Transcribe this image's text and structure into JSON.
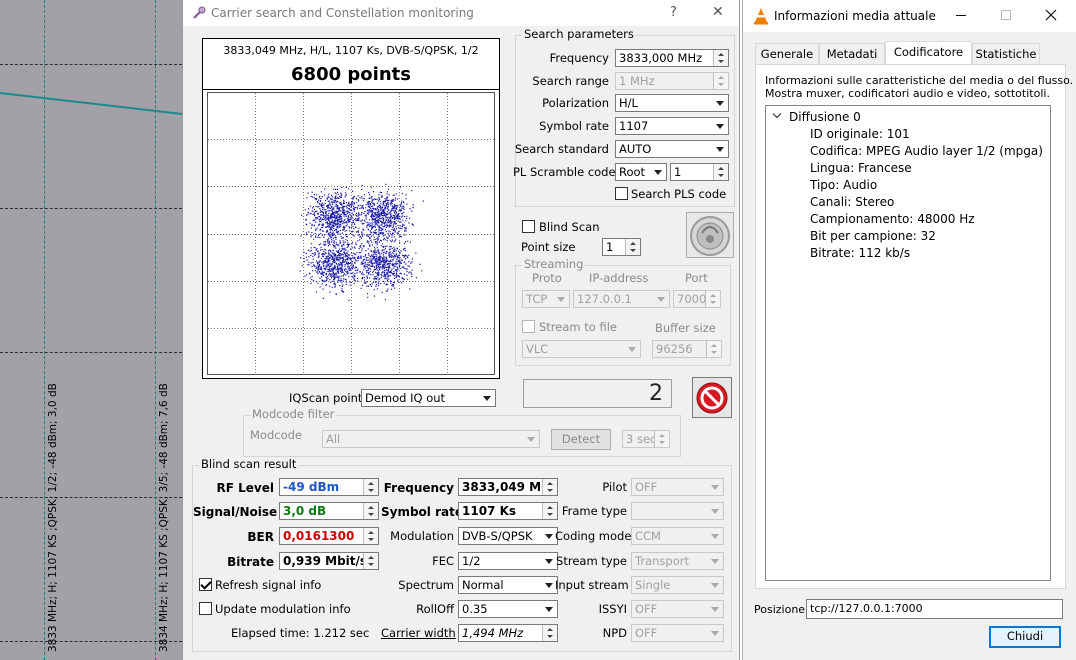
{
  "background_spectrum": {
    "carrier_label_1": "3833 MHz; H; 1107 KS ;QPSK; 1/2; -48 dBm; 3,0 dB",
    "carrier_label_2": "3834 MHz; H; 1107 KS ;QPSK; 3/5; -48 dBm; 7,6 dB"
  },
  "main_window": {
    "title": "Carrier search and Constellation monitoring",
    "help_label": "?",
    "close_label": "✕",
    "constellation": {
      "info": "3833,049 MHz, H/L, 1107 Ks, DVB-S/QPSK, 1/2",
      "points_label": "6800 points"
    },
    "search_parameters": {
      "title": "Search parameters",
      "frequency_label": "Frequency",
      "frequency_value": "3833,000 MHz",
      "search_range_label": "Search range",
      "search_range_value": "1 MHz",
      "polarization_label": "Polarization",
      "polarization_value": "H/L",
      "symbol_rate_label": "Symbol rate",
      "symbol_rate_value": "1107",
      "search_standard_label": "Search standard",
      "search_standard_value": "AUTO",
      "pl_scramble_label": "PL Scramble code",
      "pl_scramble_mode": "Root",
      "pl_scramble_value": "1",
      "search_pls_label": "Search PLS code"
    },
    "blind_scan_label": "Blind Scan",
    "point_size_label": "Point size",
    "point_size_value": "1",
    "streaming": {
      "title": "Streaming",
      "proto_label": "Proto",
      "ip_label": "IP-address",
      "port_label": "Port",
      "proto_value": "TCP",
      "ip_value": "127.0.0.1",
      "port_value": "7000",
      "stream_to_file_label": "Stream to file",
      "buffer_size_label": "Buffer size",
      "player_value": "VLC",
      "buffer_size_value": "96256"
    },
    "counter_value": "2",
    "iqscan_label": "IQScan point",
    "iqscan_value": "Demod IQ out",
    "modcode_filter": {
      "title": "Modcode filter",
      "modcode_label": "Modcode",
      "modcode_value": "All",
      "detect_label": "Detect",
      "timeout_value": "3 sec"
    },
    "blind_scan_result": {
      "title": "Blind scan result",
      "rf_level_label": "RF Level",
      "rf_level_value": "-49 dBm",
      "signal_noise_label": "Signal/Noise",
      "signal_noise_value": "3,0 dB",
      "ber_label": "BER",
      "ber_value": "0,0161300",
      "bitrate_label": "Bitrate",
      "bitrate_value": "0,939 Mbit/s",
      "frequency_label": "Frequency",
      "frequency_value": "3833,049 MHz",
      "symbol_rate_label": "Symbol rate",
      "symbol_rate_value": "1107 Ks",
      "modulation_label": "Modulation",
      "modulation_value": "DVB-S/QPSK",
      "fec_label": "FEC",
      "fec_value": "1/2",
      "spectrum_label": "Spectrum",
      "spectrum_value": "Normal",
      "rolloff_label": "RollOff",
      "rolloff_value": "0.35",
      "carrier_width_label": "Carrier width",
      "carrier_width_value": "1,494 MHz",
      "pilot_label": "Pilot",
      "pilot_value": "OFF",
      "frame_type_label": "Frame type",
      "frame_type_value": "",
      "coding_mode_label": "Coding mode",
      "coding_mode_value": "CCM",
      "stream_type_label": "Stream type",
      "stream_type_value": "Transport",
      "input_stream_label": "Input stream",
      "input_stream_value": "Single",
      "issyi_label": "ISSYI",
      "issyi_value": "OFF",
      "npd_label": "NPD",
      "npd_value": "OFF",
      "refresh_label": "Refresh signal info",
      "update_label": "Update modulation info",
      "elapsed_label": "Elapsed time: 1.212 sec"
    },
    "colors": {
      "constellation_points": "#1a1aa8",
      "rf_level": "#1f57c9",
      "signal_noise": "#107a10",
      "ber": "#d00000",
      "stop": "#d81820"
    }
  },
  "info_window": {
    "title": "Informazioni media attuale",
    "tabs": [
      "Generale",
      "Metadati",
      "Codificatore",
      "Statistiche"
    ],
    "description_line1": "Informazioni sulle caratteristiche del media o del flusso.",
    "description_line2": "Mostra muxer, codificatori audio e video, sottotitoli.",
    "tree": {
      "root": "Diffusione 0",
      "items": [
        "ID originale: 101",
        "Codifica: MPEG Audio layer 1/2 (mpga)",
        "Lingua: Francese",
        "Tipo: Audio",
        "Canali: Stereo",
        "Campionamento: 48000 Hz",
        "Bit per campione: 32",
        "Bitrate: 112 kb/s"
      ]
    },
    "position_label": "Posizione:",
    "position_value": "tcp://127.0.0.1:7000",
    "close_button": "Chiudi",
    "accent": "#0078d7"
  }
}
